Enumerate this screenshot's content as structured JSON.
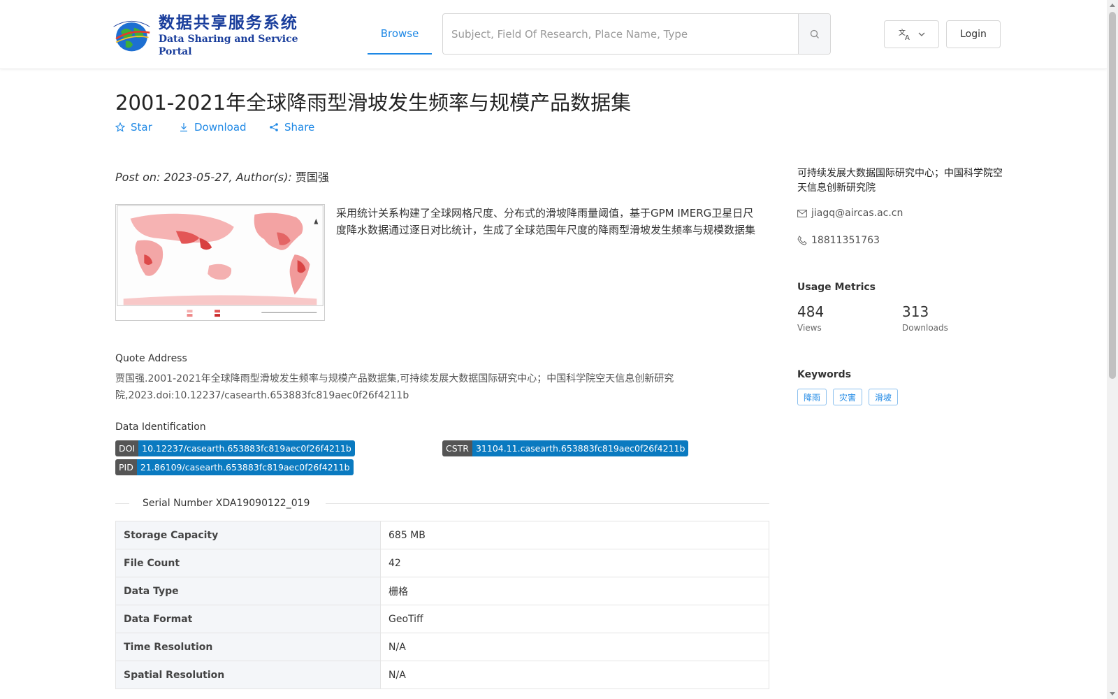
{
  "header": {
    "logo_cn": "数据共享服务系统",
    "logo_en": "Data Sharing and Service Portal",
    "nav_browse": "Browse",
    "search_placeholder": "Subject, Field Of Research, Place Name, Type",
    "login_label": "Login"
  },
  "dataset": {
    "title": "2001-2021年全球降雨型滑坡发生频率与规模产品数据集",
    "actions": {
      "star": "Star",
      "download": "Download",
      "share": "Share"
    },
    "post_on_prefix": "Post on: 2023-05-27, Author(s):",
    "author": "贾国强",
    "abstract": "采用统计关系构建了全球网格尺度、分布式的滑坡降雨量阈值，基于GPM IMERG卫星日尺度降水数据通过逐日对比统计，生成了全球范围年尺度的降雨型滑坡发生频率与规模数据集",
    "quote_label": "Quote Address",
    "quote_text": "贾国强.2001-2021年全球降雨型滑坡发生频率与规模产品数据集,可持续发展大数据国际研究中心；中国科学院空天信息创新研究院,2023.doi:10.12237/casearth.653883fc819aec0f26f4211b",
    "identification_label": "Data Identification",
    "identifiers": {
      "doi_key": "DOI",
      "doi_value": "10.12237/casearth.653883fc819aec0f26f4211b",
      "cstr_key": "CSTR",
      "cstr_value": "31104.11.casearth.653883fc819aec0f26f4211b",
      "pid_key": "PID",
      "pid_value": "21.86109/casearth.653883fc819aec0f26f4211b"
    },
    "serial_number": "Serial Number XDA19090122_019",
    "properties": [
      {
        "key": "Storage Capacity",
        "value": "685 MB"
      },
      {
        "key": "File Count",
        "value": "42"
      },
      {
        "key": "Data Type",
        "value": "栅格"
      },
      {
        "key": "Data Format",
        "value": "GeoTiff"
      },
      {
        "key": "Time Resolution",
        "value": "N/A"
      },
      {
        "key": "Spatial Resolution",
        "value": "N/A"
      }
    ]
  },
  "sidebar": {
    "organization": "可持续发展大数据国际研究中心；中国科学院空天信息创新研究院",
    "email": "jiagq@aircas.ac.cn",
    "phone": "18811351763",
    "metrics_heading": "Usage Metrics",
    "views_value": "484",
    "views_label": "Views",
    "downloads_value": "313",
    "downloads_label": "Downloads",
    "keywords_heading": "Keywords",
    "keywords": [
      "降雨",
      "灾害",
      "滑坡"
    ]
  },
  "colors": {
    "accent": "#1e88e5",
    "badge_key": "#555555",
    "badge_value": "#0a7ac0",
    "logo_blue": "#1a3e9c"
  }
}
